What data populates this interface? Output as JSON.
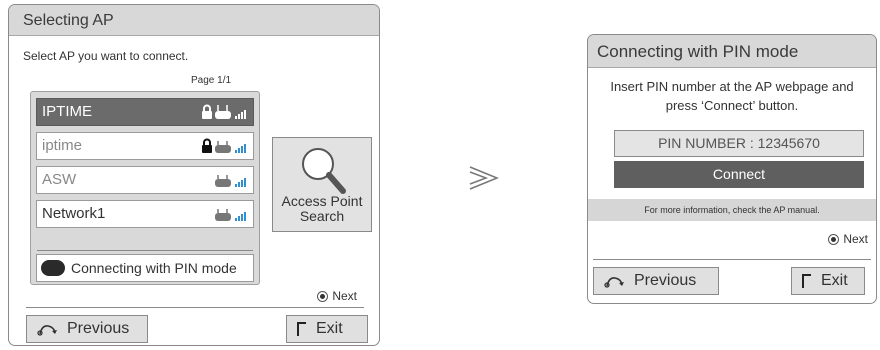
{
  "left_dialog": {
    "title": "Selecting AP",
    "instruction": "Select AP you want to connect.",
    "page": "Page 1/1",
    "ap_list": [
      {
        "name": "IPTIME",
        "selected": true,
        "locked": true
      },
      {
        "name": "iptime",
        "selected": false,
        "locked": true
      },
      {
        "name": "ASW",
        "selected": false,
        "locked": false
      },
      {
        "name": "Network1",
        "selected": false,
        "locked": false
      }
    ],
    "pin_mode_label": "Connecting with PIN mode",
    "search_button_line1": "Access Point",
    "search_button_line2": "Search",
    "next_label": "Next",
    "previous_label": "Previous",
    "exit_label": "Exit"
  },
  "arrow_icon": "chevron-right-icon",
  "right_dialog": {
    "title": "Connecting with PIN mode",
    "instruction_line1": "Insert PIN number at the AP webpage and",
    "instruction_line2": "press ‘Connect’ button.",
    "pin_field": "PIN NUMBER : 12345670",
    "connect_label": "Connect",
    "info_text": "For more information, check the AP manual.",
    "next_label": "Next",
    "previous_label": "Previous",
    "exit_label": "Exit"
  },
  "colors": {
    "title_bar": "#d8d8d8",
    "selected_item": "#6b6b6b",
    "connect_button": "#5f5f5f",
    "signal_blue": "#2f8fd0"
  }
}
